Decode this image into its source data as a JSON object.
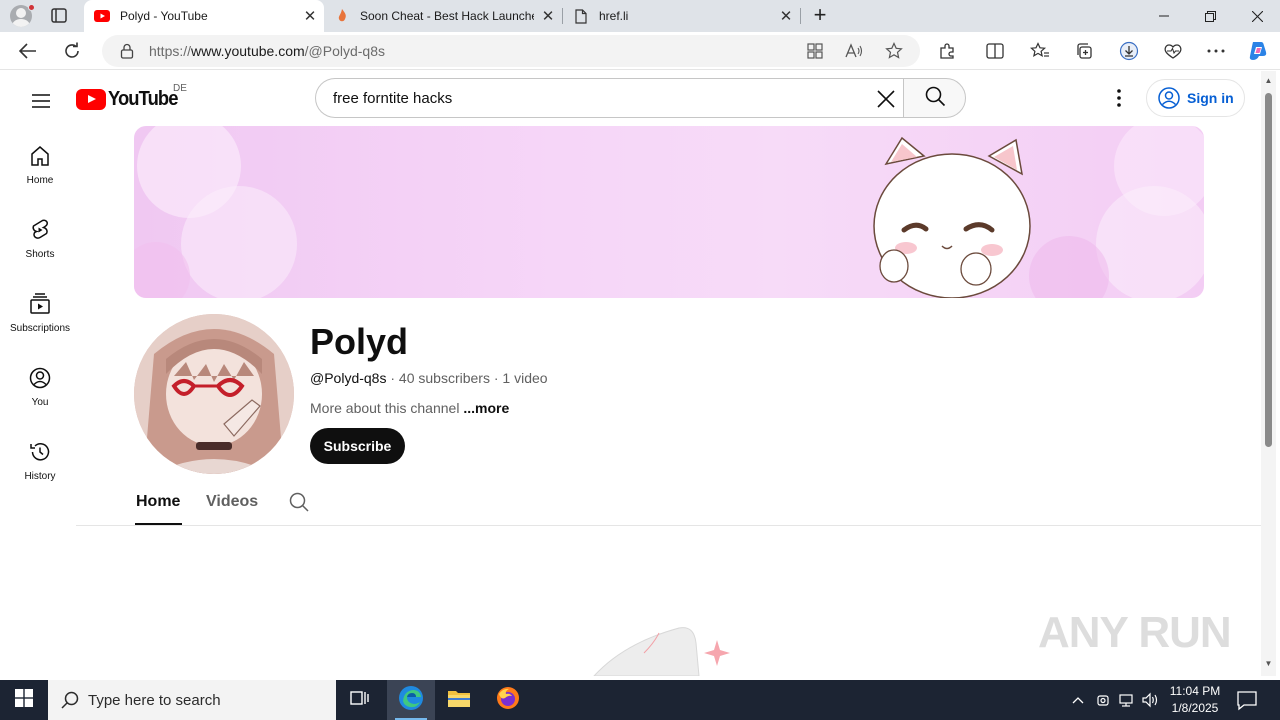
{
  "browser": {
    "tabs": [
      {
        "title": "Polyd - YouTube",
        "favicon": "youtube-icon",
        "active": true
      },
      {
        "title": "Soon Cheat - Best Hack Launche",
        "favicon": "flame-icon",
        "active": false
      },
      {
        "title": "href.li",
        "favicon": "page-icon",
        "active": false
      }
    ],
    "address": {
      "prefix": "https://",
      "host": "www.youtube.com",
      "path": "/@Polyd-q8s"
    }
  },
  "youtube": {
    "logo_text": "YouTube",
    "country_code": "DE",
    "search_query": "free forntite hacks",
    "sign_in_label": "Sign in",
    "sidebar": [
      {
        "label": "Home",
        "icon": "home-icon"
      },
      {
        "label": "Shorts",
        "icon": "shorts-icon"
      },
      {
        "label": "Subscriptions",
        "icon": "subscriptions-icon"
      },
      {
        "label": "You",
        "icon": "you-icon"
      },
      {
        "label": "History",
        "icon": "history-icon"
      }
    ],
    "channel": {
      "name": "Polyd",
      "handle": "@Polyd-q8s",
      "subscribers": "40 subscribers",
      "videos": "1 video",
      "description": "More about this channel",
      "more_label": "...more",
      "subscribe_label": "Subscribe",
      "tabs": [
        "Home",
        "Videos"
      ],
      "active_tab": "Home"
    }
  },
  "watermark": "ANY RUN",
  "taskbar": {
    "search_placeholder": "Type here to search",
    "time": "11:04 PM",
    "date": "1/8/2025"
  },
  "colors": {
    "youtube_red": "#ff0000",
    "link_blue": "#065fd4",
    "banner_pink": "#f3cdf4",
    "taskbar": "#1c2433"
  }
}
